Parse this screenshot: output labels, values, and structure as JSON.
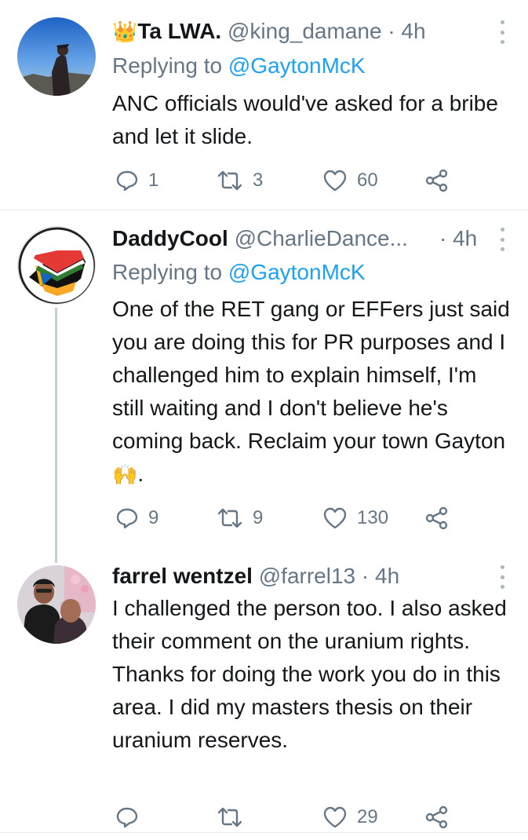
{
  "tweets": [
    {
      "name": "Ta LWA.",
      "name_prefix_icon": "crown-emoji",
      "handle": "@king_damane",
      "separator": "·",
      "time": "4h",
      "replying_prefix": "Replying to",
      "replying_to": "@GaytonMcK",
      "text": "ANC officials would've asked for a bribe and let it slide.",
      "reply_count": "1",
      "retweet_count": "3",
      "like_count": "60"
    },
    {
      "name": "DaddyCool",
      "handle": "@CharlieDance...",
      "separator": "·",
      "time": "4h",
      "replying_prefix": "Replying to",
      "replying_to": "@GaytonMcK",
      "text": "One of the RET gang or EFFers just said you are doing this for PR purposes and I challenged him to explain himself, I'm still waiting and I don't believe he's coming back. Reclaim your town Gayton",
      "text_suffix_icon": "raising-hands-emoji",
      "text_end": ".",
      "avatar_text": "PROUDLY SOUTH AFRICAN",
      "reply_count": "9",
      "retweet_count": "9",
      "like_count": "130"
    },
    {
      "name": "farrel wentzel",
      "handle": "@farrel13",
      "separator": "·",
      "time": "4h",
      "text": "I challenged the person too. I also asked their comment on the uranium rights. Thanks for doing the work you do in this area. I did my masters thesis on their uranium reserves.",
      "reply_count": "",
      "retweet_count": "",
      "like_count": "29"
    }
  ],
  "colors": {
    "text": "#14171a",
    "secondary": "#657786",
    "link": "#1da1f2",
    "divider": "#e6ecf0",
    "thread_line": "#c4cfd6"
  }
}
